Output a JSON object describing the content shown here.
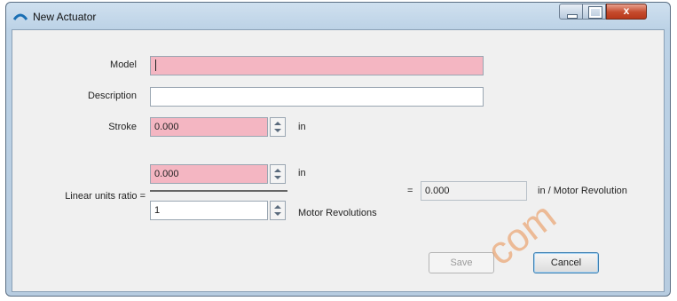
{
  "window": {
    "title": "New Actuator",
    "close_glyph": "x"
  },
  "form": {
    "model_label": "Model",
    "model_value": "",
    "description_label": "Description",
    "description_value": "",
    "stroke_label": "Stroke",
    "stroke_value": "0.000",
    "stroke_unit": "in",
    "ratio_label": "Linear units ratio =",
    "ratio_numerator_value": "0.000",
    "ratio_numerator_unit": "in",
    "ratio_denominator_value": "1",
    "ratio_denominator_unit": "Motor Revolutions",
    "equals": "=",
    "result_value": "0.000",
    "result_unit": "in / Motor Revolution"
  },
  "buttons": {
    "save": "Save",
    "cancel": "Cancel"
  },
  "watermark": {
    "text": "com"
  },
  "colors": {
    "invalid_field": "#f4b6c2",
    "accent": "#3c7fb1"
  }
}
